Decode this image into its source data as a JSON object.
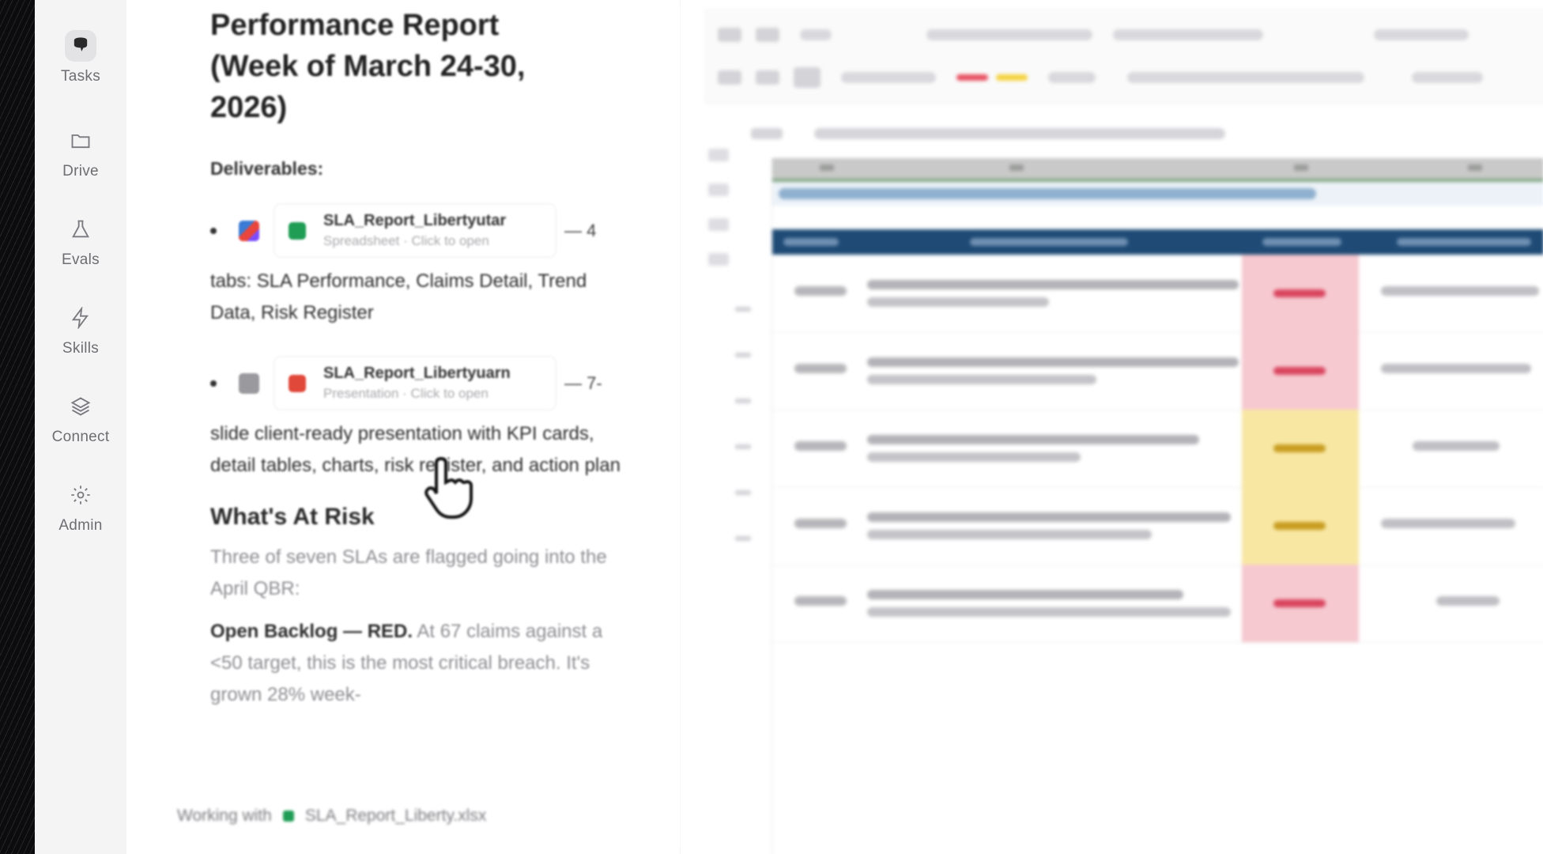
{
  "sidebar": {
    "items": [
      {
        "label": "Tasks",
        "icon": "tasks-icon",
        "active": true
      },
      {
        "label": "Drive",
        "icon": "folder-icon",
        "active": false
      },
      {
        "label": "Evals",
        "icon": "flask-icon",
        "active": false
      },
      {
        "label": "Skills",
        "icon": "lightning-icon",
        "active": false
      },
      {
        "label": "Connect",
        "icon": "layers-icon",
        "active": false
      },
      {
        "label": "Admin",
        "icon": "gear-icon",
        "active": false
      }
    ]
  },
  "report": {
    "title_line1": "Performance Report",
    "title_line2": "(Week of March 24-30,",
    "title_line3": "2026)",
    "deliverables_label": "Deliverables:",
    "deliverable_1": {
      "name": "SLA_Report_Libertyutar",
      "subtitle": "Spreadsheet · Click to open",
      "tail": "— 4",
      "description": "tabs: SLA Performance, Claims Detail, Trend Data, Risk Register"
    },
    "deliverable_2": {
      "name": "SLA_Report_Libertyuarn",
      "subtitle": "Presentation · Click to open",
      "tail": "— 7-",
      "description": "slide client-ready presentation with KPI cards, detail tables, charts, risk register, and action plan"
    },
    "risk_heading": "What's At Risk",
    "risk_intro": "Three of seven SLAs are flagged going into the April QBR:",
    "risk_item_bold": "Open Backlog — RED.",
    "risk_item_text": " At 67 claims against a <50 target, this is the most critical breach. It's grown 28% week-"
  },
  "status_bar": {
    "prefix": "Working with",
    "file": "SLA_Report_Liberty.xlsx"
  },
  "colors": {
    "sheet_header": "#1e4a75",
    "status_red": "#f6c9d0",
    "status_yellow": "#f8e7a3",
    "accent_green": "#1f9d55"
  }
}
